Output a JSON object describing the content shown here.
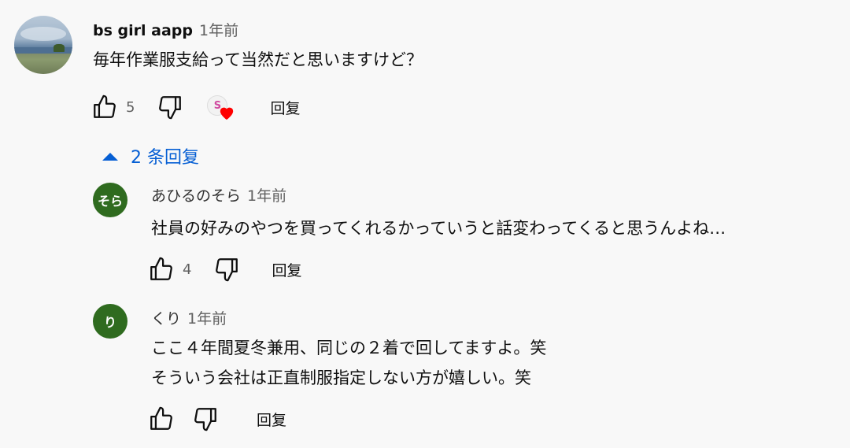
{
  "comment": {
    "author": "bs girl aapp",
    "time": "1年前",
    "text": "毎年作業服支給って当然だと思いますけど？",
    "likes": "5",
    "reply_label": "回复",
    "heart_badge_initial": "S"
  },
  "replies_toggle": {
    "label": "2 条回复"
  },
  "replies": [
    {
      "avatar_initial": "そら",
      "author": "あひるのそら",
      "time": "1年前",
      "text_lines": [
        "社員の好みのやつを買ってくれるかっていうと話変わってくると思うんよね…"
      ],
      "likes": "4",
      "reply_label": "回复"
    },
    {
      "avatar_initial": "り",
      "author": "くり",
      "time": "1年前",
      "text_lines": [
        "ここ４年間夏冬兼用、同じの２着で回してますよ。笑",
        "そういう会社は正直制服指定しない方が嬉しい。笑"
      ],
      "likes": "",
      "reply_label": "回复"
    }
  ],
  "colors": {
    "link_blue": "#065fd4",
    "avatar_green": "#2f6b1f",
    "heart_red": "#ff0000"
  }
}
